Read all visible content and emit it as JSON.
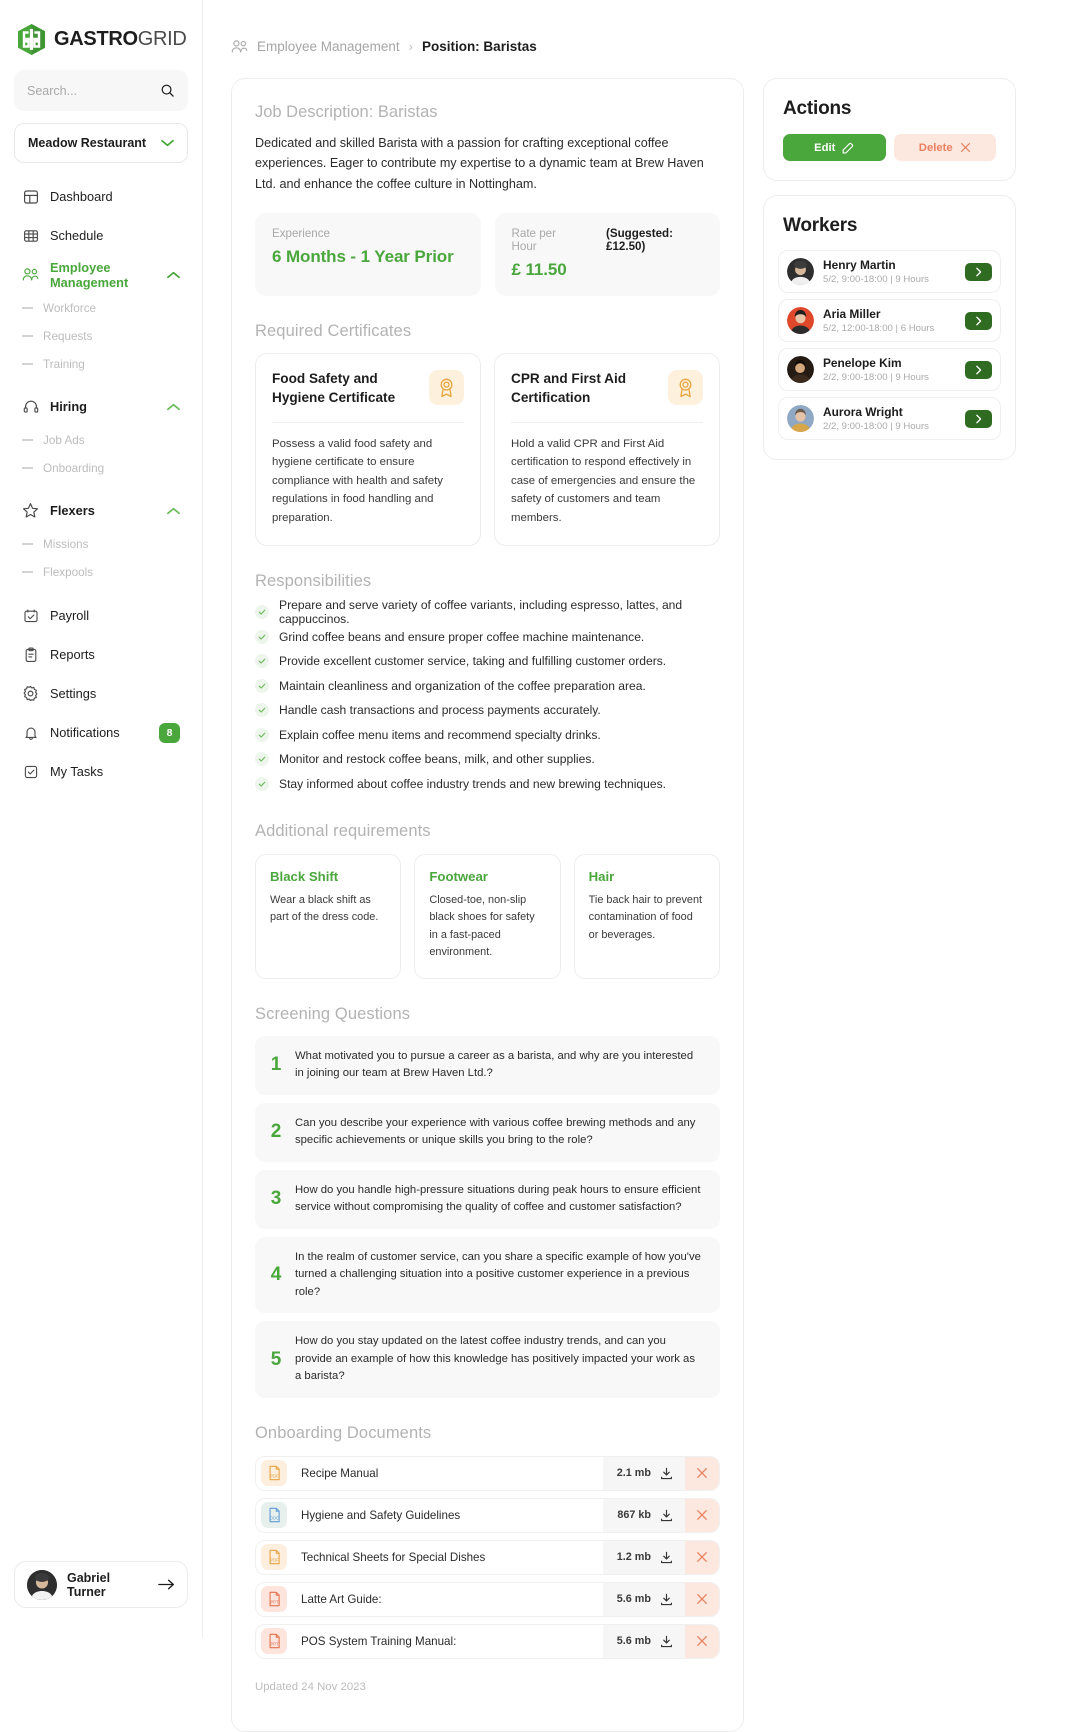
{
  "brand": {
    "name_bold": "GASTRO",
    "name_light": "GRID"
  },
  "search": {
    "placeholder": "Search..."
  },
  "restaurant": {
    "selected": "Meadow Restaurant"
  },
  "sidebar": {
    "items": [
      {
        "label": "Dashboard",
        "icon": "dashboard-icon",
        "type": "item",
        "active": false
      },
      {
        "label": "Schedule",
        "icon": "calendar-grid-icon",
        "type": "item",
        "active": false
      },
      {
        "label": "Employee Management",
        "icon": "users-icon",
        "type": "group",
        "active": true
      },
      {
        "label": "Workforce",
        "type": "sub"
      },
      {
        "label": "Requests",
        "type": "sub"
      },
      {
        "label": "Training",
        "type": "sub"
      },
      {
        "label": "Hiring",
        "icon": "headset-icon",
        "type": "group",
        "active": false
      },
      {
        "label": "Job Ads",
        "type": "sub"
      },
      {
        "label": "Onboarding",
        "type": "sub"
      },
      {
        "label": "Flexers",
        "icon": "star-icon",
        "type": "group",
        "active": false
      },
      {
        "label": "Missions",
        "type": "sub"
      },
      {
        "label": "Flexpools",
        "type": "sub"
      },
      {
        "label": "Payroll",
        "icon": "calendar-check-icon",
        "type": "item",
        "active": false
      },
      {
        "label": "Reports",
        "icon": "clipboard-icon",
        "type": "item",
        "active": false
      },
      {
        "label": "Settings",
        "icon": "gear-icon",
        "type": "item",
        "active": false
      },
      {
        "label": "Notifications",
        "icon": "bell-icon",
        "type": "item",
        "active": false,
        "badge": "8"
      },
      {
        "label": "My Tasks",
        "icon": "checkbox-icon",
        "type": "item",
        "active": false
      }
    ]
  },
  "profile": {
    "name": "Gabriel Turner"
  },
  "breadcrumb": {
    "parent": "Employee Management",
    "separator": "›",
    "current": "Position: Baristas"
  },
  "job": {
    "heading": "Job Description: Baristas",
    "description": "Dedicated and skilled Barista with a passion for crafting exceptional coffee experiences. Eager to contribute my expertise to a dynamic team at Brew Haven Ltd. and enhance the coffee culture in Nottingham.",
    "experience_label": "Experience",
    "experience_value": "6 Months - 1 Year Prior",
    "rate_label": "Rate per Hour",
    "rate_suggested": "(Suggested: £12.50)",
    "rate_value": "£ 11.50"
  },
  "certificates": {
    "title": "Required Certificates",
    "items": [
      {
        "name": "Food Safety and Hygiene Certificate",
        "desc": "Possess a valid food safety and hygiene certificate to ensure compliance with health and safety regulations in food handling and preparation.",
        "icon": "award-ribbon-icon"
      },
      {
        "name": "CPR and First Aid Certification",
        "desc": "Hold a valid CPR and First Aid certification to respond effectively in case of emergencies and ensure the safety of customers and team members.",
        "icon": "award-ribbon-icon"
      }
    ]
  },
  "responsibilities": {
    "title": "Responsibilities",
    "items": [
      "Prepare and serve variety of coffee variants, including espresso, lattes, and cappuccinos.",
      "Grind coffee beans and ensure proper coffee machine maintenance.",
      "Provide excellent customer service, taking and fulfilling customer orders.",
      "Maintain cleanliness and organization of the coffee preparation area.",
      "Handle cash transactions and process payments accurately.",
      "Explain coffee menu items and recommend specialty drinks.",
      "Monitor and restock coffee beans, milk, and other supplies.",
      "Stay informed about coffee industry trends and new brewing techniques."
    ]
  },
  "additional_requirements": {
    "title": "Additional requirements",
    "items": [
      {
        "title": "Black Shift",
        "desc": "Wear a black shift as part of the dress code."
      },
      {
        "title": "Footwear",
        "desc": "Closed-toe, non-slip black shoes for safety in a fast-paced environment."
      },
      {
        "title": "Hair",
        "desc": "Tie back hair to prevent contamination of food or beverages."
      }
    ]
  },
  "screening": {
    "title": "Screening Questions",
    "items": [
      {
        "num": "1",
        "text": "What motivated you to pursue a career as a barista, and why are you interested in joining our team at Brew Haven Ltd.?"
      },
      {
        "num": "2",
        "text": "Can you describe your experience with various coffee brewing methods and any specific achievements or unique skills you bring to the role?"
      },
      {
        "num": "3",
        "text": "How do you handle high-pressure situations during peak hours to ensure efficient service without compromising the quality of coffee and customer satisfaction?"
      },
      {
        "num": "4",
        "text": "In the realm of customer service, can you share a specific example of how you've turned a challenging situation into a positive customer experience in a previous role?"
      },
      {
        "num": "5",
        "text": "How do you stay updated on the latest coffee industry trends, and can you provide an example of how this knowledge has positively impacted your work as a barista?"
      }
    ]
  },
  "documents": {
    "title": "Onboarding Documents",
    "items": [
      {
        "name": "Recipe Manual",
        "size": "2.1 mb",
        "type": "PDF"
      },
      {
        "name": "Hygiene and Safety Guidelines",
        "size": "867 kb",
        "type": "DOC"
      },
      {
        "name": "Technical Sheets for Special Dishes",
        "size": "1.2 mb",
        "type": "PDF"
      },
      {
        "name": "Latte Art Guide:",
        "size": "5.6 mb",
        "type": "PPT"
      },
      {
        "name": "POS System Training Manual:",
        "size": "5.6 mb",
        "type": "PPT"
      }
    ]
  },
  "footer": {
    "updated": "Updated 24 Nov 2023"
  },
  "actions": {
    "title": "Actions",
    "edit_label": "Edit",
    "delete_label": "Delete"
  },
  "workers": {
    "title": "Workers",
    "items": [
      {
        "name": "Henry Martin",
        "meta": "5/2, 9:00-18:00 | 9 Hours",
        "avatar": "#3b3b3b"
      },
      {
        "name": "Aria Miller",
        "meta": "5/2, 12:00-18:00 | 6 Hours",
        "avatar": "#e0482c"
      },
      {
        "name": "Penelope Kim",
        "meta": "2/2, 9:00-18:00 | 9 Hours",
        "avatar": "#2a2118"
      },
      {
        "name": "Aurora Wright",
        "meta": "2/2, 9:00-18:00 | 9 Hours",
        "avatar": "#8fa9c4"
      }
    ]
  },
  "colors": {
    "brand_green": "#4aa73c",
    "dark_green": "#2f6b21",
    "danger": "#e98060",
    "danger_bg": "#fde8e0"
  }
}
